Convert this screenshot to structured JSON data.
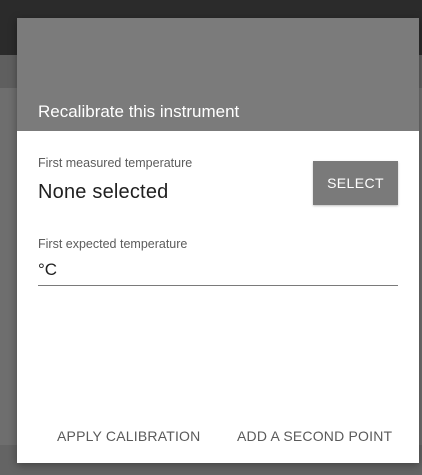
{
  "dialog": {
    "title": "Recalibrate this instrument",
    "first_measured": {
      "label": "First measured temperature",
      "value": "None selected",
      "button_label": "SELECT"
    },
    "first_expected": {
      "label": "First expected temperature",
      "unit": "°C"
    },
    "actions": {
      "apply": "APPLY CALIBRATION",
      "add_second": "ADD A SECOND POINT"
    }
  },
  "colors": {
    "header_gray": "#7b7b7b",
    "button_gray": "#7a7a7a",
    "backdrop": "#6e6e6e",
    "topbar": "#2b2b2b"
  }
}
